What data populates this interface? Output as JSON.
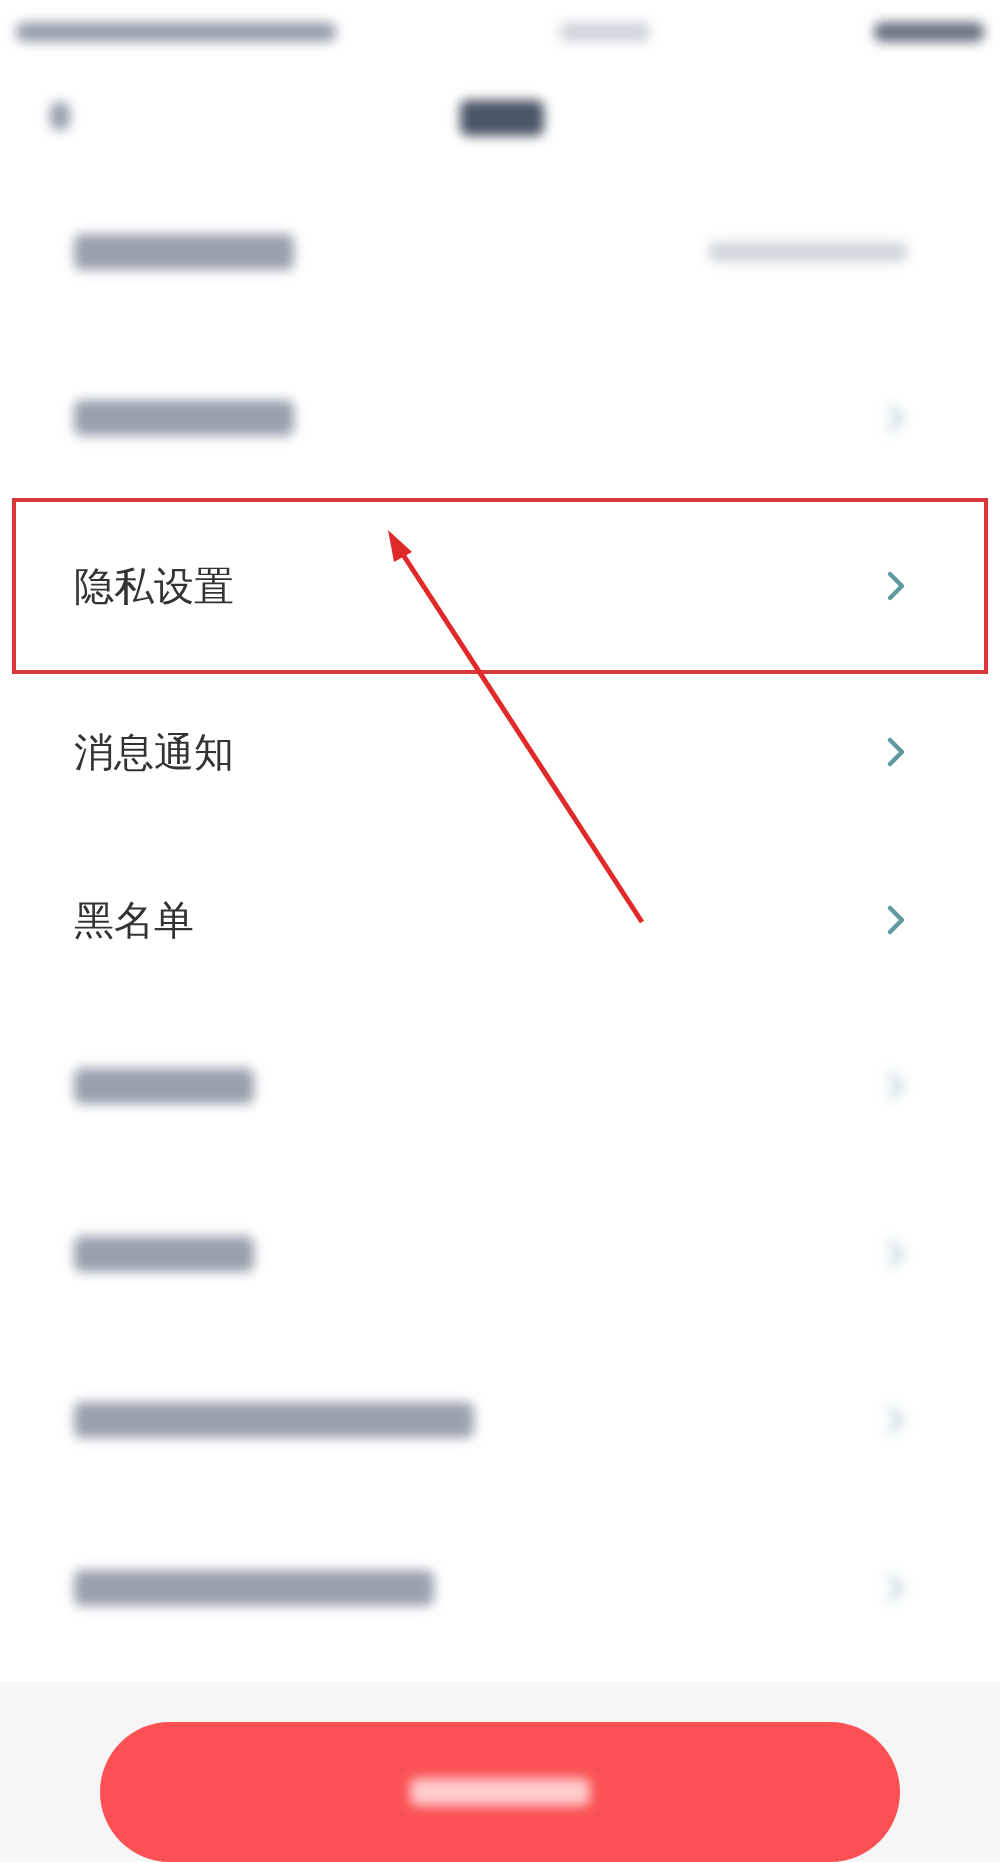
{
  "rows": [
    {
      "kind": "blurred",
      "has_value": true,
      "highlighted": false
    },
    {
      "kind": "blurred",
      "has_value": false,
      "highlighted": false
    },
    {
      "kind": "item",
      "label": "隐私设置",
      "highlighted": true
    },
    {
      "kind": "item",
      "label": "消息通知",
      "highlighted": false
    },
    {
      "kind": "item",
      "label": "黑名单",
      "highlighted": false
    },
    {
      "kind": "blurred",
      "has_value": false,
      "highlighted": false
    },
    {
      "kind": "blurred",
      "has_value": false,
      "highlighted": false
    },
    {
      "kind": "blurred",
      "has_value": false,
      "highlighted": false
    },
    {
      "kind": "blurred",
      "has_value": false,
      "highlighted": false
    }
  ]
}
